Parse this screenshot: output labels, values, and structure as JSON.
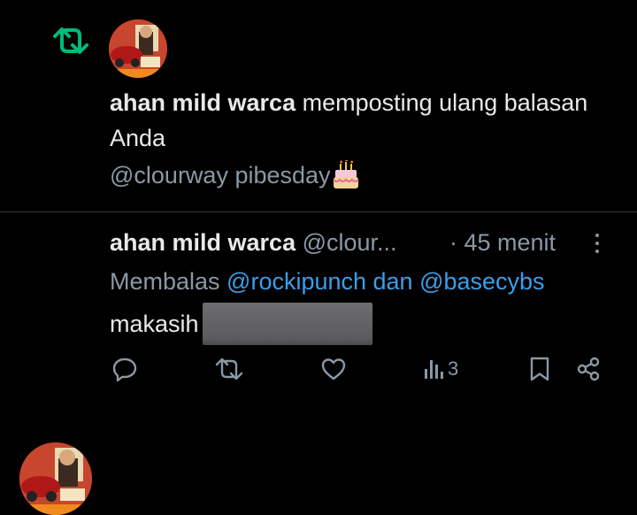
{
  "notification": {
    "type_icon": "repost-icon",
    "actor_name": "ahan mild warca",
    "action_text": " memposting ulang balasan Anda",
    "quoted_text": "@clourway pibesday",
    "quoted_emoji": "cake-icon"
  },
  "tweet": {
    "author_name": "ahan mild warca",
    "author_handle": "@clour...",
    "time": "· 45 menit",
    "reply_prefix": "Membalas ",
    "reply_targets": "@rockipunch dan @basecybs",
    "body_text": "makasih",
    "actions": {
      "reply_icon": "reply-icon",
      "repost_icon": "repost-icon",
      "like_icon": "heart-icon",
      "views_icon": "views-icon",
      "views_count": "3",
      "bookmark_icon": "bookmark-icon",
      "share_icon": "share-icon"
    }
  },
  "colors": {
    "background": "#000000",
    "text_primary": "#e7e9ea",
    "text_secondary": "#8b98a5",
    "link": "#3b9eea",
    "repost_green": "#00ba7c",
    "divider": "#2f3336"
  }
}
